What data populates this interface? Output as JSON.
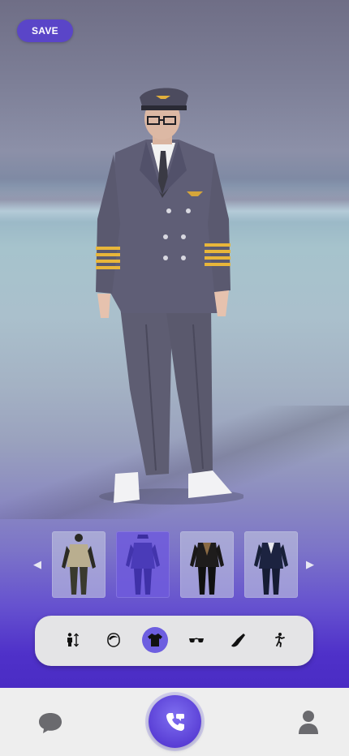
{
  "header": {
    "save_label": "SAVE"
  },
  "avatar": {
    "description_icon": "avatar-pilot-figure-icon"
  },
  "outfit_carousel": {
    "prev_icon": "chevron-left-icon",
    "next_icon": "chevron-right-icon",
    "prev_glyph": "◀",
    "next_glyph": "▶",
    "items": [
      {
        "icon": "outfit-safari-icon",
        "selected": false
      },
      {
        "icon": "outfit-pilot-icon",
        "selected": true
      },
      {
        "icon": "outfit-leather-jacket-icon",
        "selected": false
      },
      {
        "icon": "outfit-navy-suit-icon",
        "selected": false
      }
    ]
  },
  "category_bar": {
    "items": [
      {
        "icon": "body-height-icon",
        "active": false
      },
      {
        "icon": "hair-icon",
        "active": false
      },
      {
        "icon": "shirt-icon",
        "active": true
      },
      {
        "icon": "sunglasses-icon",
        "active": false
      },
      {
        "icon": "shoe-icon",
        "active": false
      },
      {
        "icon": "pose-icon",
        "active": false
      }
    ]
  },
  "bottom_nav": {
    "chat_icon": "chat-bubble-icon",
    "call_icon": "phone-call-icon",
    "profile_icon": "user-profile-icon"
  },
  "colors": {
    "accent": "#5a45c8",
    "active_category": "#6d5ee0",
    "call_button": "#5a3fd6",
    "nav_background": "#eeeeee",
    "category_bar_background": "#e4e4e6"
  }
}
